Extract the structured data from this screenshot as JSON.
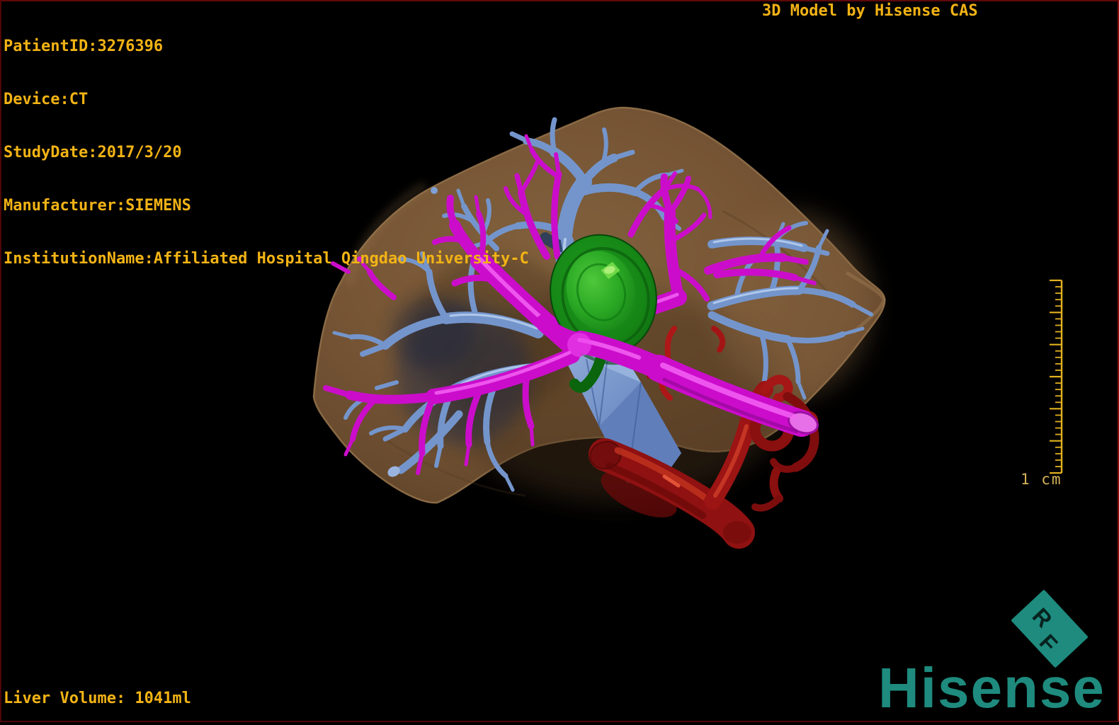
{
  "viewer": {
    "type": "3d-model-viewport",
    "background": "#000000",
    "frame_color": "#5a0a0a"
  },
  "overlay": {
    "text_color": "#f2b315",
    "patient_info": [
      "PatientID:3276396",
      "Device:CT",
      "StudyDate:2017/3/20",
      "Manufacturer:SIEMENS",
      "InstitutionName:Affiliated Hospital Qingdao University-C"
    ],
    "title": "3D Model by Hisense CAS",
    "liver_volume": "Liver Volume: 1041ml"
  },
  "scale_bar": {
    "label": "1 cm",
    "major_divisions": 6,
    "minor_subdivisions": 5,
    "color": "#e2b11f",
    "label_color": "#d6b258"
  },
  "logo": {
    "brand": "Hisense",
    "badge_r": "R",
    "badge_f": "F",
    "color": "#1e8b7e",
    "badge_letter_color": "#07231f"
  },
  "model": {
    "description": "3D liver segmentation render",
    "structures": [
      {
        "name": "liver-surface",
        "color": "#7a5837"
      },
      {
        "name": "portal-vein",
        "color": "#cb0dcb"
      },
      {
        "name": "hepatic-vein",
        "color": "#7495cc"
      },
      {
        "name": "tumor",
        "color": "#158515"
      },
      {
        "name": "ivc-and-arteries",
        "color": "#9c1414"
      }
    ]
  }
}
